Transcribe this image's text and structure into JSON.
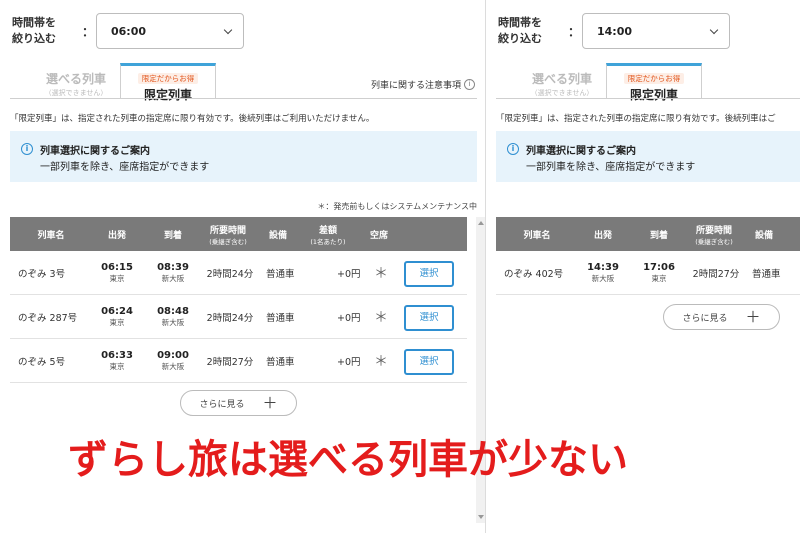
{
  "overlay_caption": "ずらし旅は選べる列車が少ない",
  "left": {
    "filter": {
      "label_line1": "時間帯を",
      "label_line2": "絞り込む",
      "colon": "：",
      "value": "06:00"
    },
    "tabs": {
      "selectable": {
        "title": "選べる列車",
        "sub": "（選択できません）"
      },
      "limited": {
        "pill": "限定だからお得",
        "title": "限定列車"
      }
    },
    "notice_link": "列車に関する注意事項",
    "description": "「限定列車」は、指定された列車の指定席に限り有効です。後続列車はご利用いただけません。",
    "infobox": {
      "title": "列車選択に関するご案内",
      "text": "一部列車を除き、座席指定ができます"
    },
    "footnote": "＊：発売前もしくはシステムメンテナンス中",
    "headers": {
      "name": "列車名",
      "depart": "出発",
      "arrive": "到着",
      "duration": "所要時間",
      "duration_sub": "(乗継ぎ含む)",
      "equipment": "設備",
      "diff": "差額",
      "diff_sub": "(1名あたり)",
      "vacancy": "空席"
    },
    "rows": [
      {
        "name": "のぞみ 3号",
        "dep_time": "06:15",
        "dep_st": "東京",
        "arr_time": "08:39",
        "arr_st": "新大阪",
        "duration": "2時間24分",
        "equipment": "普通車",
        "diff": "+0円",
        "vacancy": "＊",
        "button": "選択"
      },
      {
        "name": "のぞみ 287号",
        "dep_time": "06:24",
        "dep_st": "東京",
        "arr_time": "08:48",
        "arr_st": "新大阪",
        "duration": "2時間24分",
        "equipment": "普通車",
        "diff": "+0円",
        "vacancy": "＊",
        "button": "選択"
      },
      {
        "name": "のぞみ 5号",
        "dep_time": "06:33",
        "dep_st": "東京",
        "arr_time": "09:00",
        "arr_st": "新大阪",
        "duration": "2時間27分",
        "equipment": "普通車",
        "diff": "+0円",
        "vacancy": "＊",
        "button": "選択"
      }
    ],
    "more_button": "さらに見る",
    "more_plus": "＋"
  },
  "right": {
    "filter": {
      "label_line1": "時間帯を",
      "label_line2": "絞り込む",
      "colon": "：",
      "value": "14:00"
    },
    "tabs": {
      "selectable": {
        "title": "選べる列車",
        "sub": "（選択できません）"
      },
      "limited": {
        "pill": "限定だからお得",
        "title": "限定列車"
      }
    },
    "description": "「限定列車」は、指定された列車の指定席に限り有効です。後続列車はご",
    "infobox": {
      "title": "列車選択に関するご案内",
      "text": "一部列車を除き、座席指定ができます"
    },
    "headers": {
      "name": "列車名",
      "depart": "出発",
      "arrive": "到着",
      "duration": "所要時間",
      "duration_sub": "(乗継ぎ含む)",
      "equipment": "設備"
    },
    "rows": [
      {
        "name": "のぞみ 402号",
        "dep_time": "14:39",
        "dep_st": "新大阪",
        "arr_time": "17:06",
        "arr_st": "東京",
        "duration": "2時間27分",
        "equipment": "普通車"
      }
    ],
    "more_button": "さらに見る",
    "more_plus": "＋"
  },
  "colors": {
    "accent_blue": "#2f8fd1",
    "tab_top": "#3fa3d9",
    "header_gray": "#7a7a7a",
    "caption_red": "#e41c1c",
    "pill_orange": "#e2561d"
  }
}
